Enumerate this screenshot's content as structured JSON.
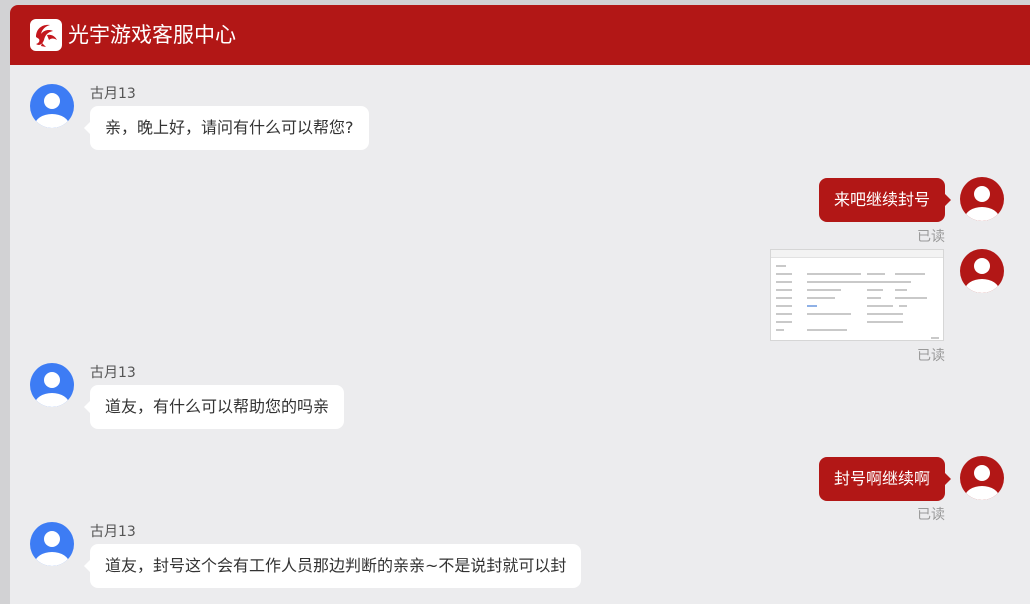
{
  "header": {
    "title": "光宇游戏客服中心",
    "brand_color": "#b21716",
    "logo_icon": "dragon-logo-icon"
  },
  "messages": [
    {
      "side": "incoming",
      "sender": "古月13",
      "text": "亲，晚上好，请问有什么可以帮您?"
    },
    {
      "side": "outgoing",
      "text": "来吧继续封号",
      "status": "已读"
    },
    {
      "side": "outgoing",
      "type": "image",
      "image_desc": "screenshot-thumbnail",
      "status": "已读"
    },
    {
      "side": "incoming",
      "sender": "古月13",
      "text": "道友，有什么可以帮助您的吗亲"
    },
    {
      "side": "outgoing",
      "text": "封号啊继续啊",
      "status": "已读"
    },
    {
      "side": "incoming",
      "sender": "古月13",
      "text": "道友，封号这个会有工作人员那边判断的亲亲~不是说封就可以封"
    }
  ],
  "colors": {
    "agent_avatar": "#3d7cf4",
    "user_avatar": "#b21716",
    "incoming_bubble": "#ffffff",
    "outgoing_bubble": "#b21716",
    "background": "#ececee"
  }
}
